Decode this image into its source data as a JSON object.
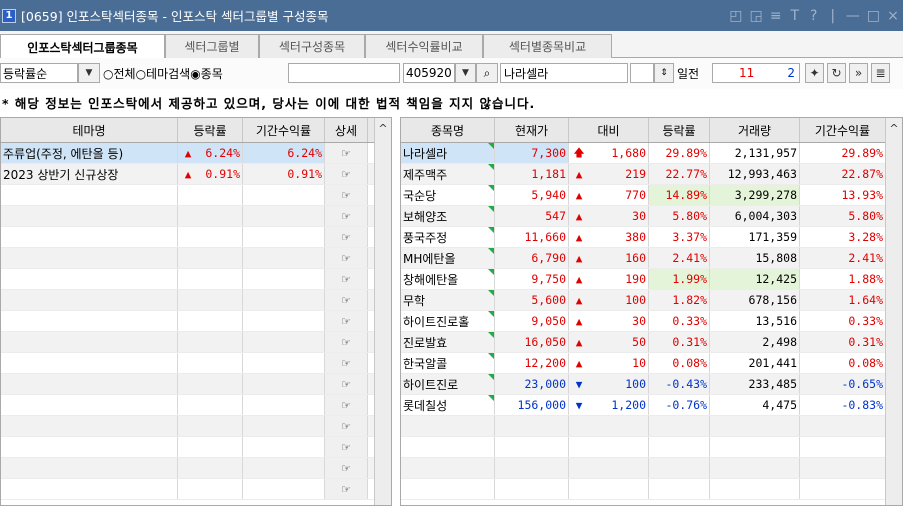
{
  "window": {
    "number": "1",
    "title": "[0659] 인포스탁섹터종목 - 인포스탁 섹터그룹별 구성종목",
    "controls": [
      "◰",
      "◲",
      "≡",
      "T",
      "?",
      "|",
      "—",
      "□",
      "×"
    ]
  },
  "tabs": [
    "인포스탁섹터그룹종목",
    "섹터그룹별",
    "섹터구성종목",
    "섹터수익률비교",
    "섹터별종목비교"
  ],
  "controls": {
    "sort_label": "등락률순",
    "radio_all": "○전체",
    "radio_theme": "○테마검색",
    "radio_stock": "◉종목",
    "code": "405920",
    "stock_name": "나라셀라",
    "days_label": "일전",
    "days_value": "11",
    "period_value": "2"
  },
  "notice": "* 해당 정보는 인포스탁에서 제공하고 있으며, 당사는 이에 대한 법적 책임을 지지 않습니다.",
  "theme_grid": {
    "headers": [
      "테마명",
      "등락률",
      "기간수익률",
      "상세"
    ],
    "rows": [
      {
        "name": "주류업(주정, 에탄올 등)",
        "arrow": "▲",
        "rate": "6.24%",
        "period": "6.24%",
        "selected": true
      },
      {
        "name": "2023 상반기 신규상장",
        "arrow": "▲",
        "rate": "0.91%",
        "period": "0.91%",
        "selected": false
      },
      {
        "name": "",
        "arrow": "",
        "rate": "",
        "period": ""
      },
      {
        "name": "",
        "arrow": "",
        "rate": "",
        "period": ""
      },
      {
        "name": "",
        "arrow": "",
        "rate": "",
        "period": ""
      },
      {
        "name": "",
        "arrow": "",
        "rate": "",
        "period": ""
      },
      {
        "name": "",
        "arrow": "",
        "rate": "",
        "period": ""
      },
      {
        "name": "",
        "arrow": "",
        "rate": "",
        "period": ""
      },
      {
        "name": "",
        "arrow": "",
        "rate": "",
        "period": ""
      },
      {
        "name": "",
        "arrow": "",
        "rate": "",
        "period": ""
      },
      {
        "name": "",
        "arrow": "",
        "rate": "",
        "period": ""
      },
      {
        "name": "",
        "arrow": "",
        "rate": "",
        "period": ""
      },
      {
        "name": "",
        "arrow": "",
        "rate": "",
        "period": ""
      },
      {
        "name": "",
        "arrow": "",
        "rate": "",
        "period": ""
      },
      {
        "name": "",
        "arrow": "",
        "rate": "",
        "period": ""
      },
      {
        "name": "",
        "arrow": "",
        "rate": "",
        "period": ""
      },
      {
        "name": "",
        "arrow": "",
        "rate": "",
        "period": ""
      }
    ],
    "detail_icon": "☞"
  },
  "stock_grid": {
    "headers": [
      "종목명",
      "현재가",
      "대비",
      "등락률",
      "거래량",
      "기간수익률"
    ],
    "rows": [
      {
        "name": "나라셀라",
        "price": "7,300",
        "arrow": "🡅",
        "change": "1,680",
        "rate": "29.89%",
        "volume": "2,131,957",
        "period": "29.89%",
        "dir": "up",
        "selected": true
      },
      {
        "name": "제주맥주",
        "price": "1,181",
        "arrow": "▲",
        "change": "219",
        "rate": "22.77%",
        "volume": "12,993,463",
        "period": "22.87%",
        "dir": "up"
      },
      {
        "name": "국순당",
        "price": "5,940",
        "arrow": "▲",
        "change": "770",
        "rate": "14.89%",
        "volume": "3,299,278",
        "period": "13.93%",
        "dir": "up",
        "hl": true
      },
      {
        "name": "보해양조",
        "price": "547",
        "arrow": "▲",
        "change": "30",
        "rate": "5.80%",
        "volume": "6,004,303",
        "period": "5.80%",
        "dir": "up"
      },
      {
        "name": "풍국주정",
        "price": "11,660",
        "arrow": "▲",
        "change": "380",
        "rate": "3.37%",
        "volume": "171,359",
        "period": "3.28%",
        "dir": "up"
      },
      {
        "name": "MH에탄올",
        "price": "6,790",
        "arrow": "▲",
        "change": "160",
        "rate": "2.41%",
        "volume": "15,808",
        "period": "2.41%",
        "dir": "up"
      },
      {
        "name": "창해에탄올",
        "price": "9,750",
        "arrow": "▲",
        "change": "190",
        "rate": "1.99%",
        "volume": "12,425",
        "period": "1.88%",
        "dir": "up",
        "hl": true
      },
      {
        "name": "무학",
        "price": "5,600",
        "arrow": "▲",
        "change": "100",
        "rate": "1.82%",
        "volume": "678,156",
        "period": "1.64%",
        "dir": "up"
      },
      {
        "name": "하이트진로홀",
        "price": "9,050",
        "arrow": "▲",
        "change": "30",
        "rate": "0.33%",
        "volume": "13,516",
        "period": "0.33%",
        "dir": "up"
      },
      {
        "name": "진로발효",
        "price": "16,050",
        "arrow": "▲",
        "change": "50",
        "rate": "0.31%",
        "volume": "2,498",
        "period": "0.31%",
        "dir": "up"
      },
      {
        "name": "한국알콜",
        "price": "12,200",
        "arrow": "▲",
        "change": "10",
        "rate": "0.08%",
        "volume": "201,441",
        "period": "0.08%",
        "dir": "up"
      },
      {
        "name": "하이트진로",
        "price": "23,000",
        "arrow": "▼",
        "change": "100",
        "rate": "-0.43%",
        "volume": "233,485",
        "period": "-0.65%",
        "dir": "down"
      },
      {
        "name": "롯데칠성",
        "price": "156,000",
        "arrow": "▼",
        "change": "1,200",
        "rate": "-0.76%",
        "volume": "4,475",
        "period": "-0.83%",
        "dir": "down"
      },
      {
        "name": "",
        "price": "",
        "arrow": "",
        "change": "",
        "rate": "",
        "volume": "",
        "period": "",
        "dir": ""
      },
      {
        "name": "",
        "price": "",
        "arrow": "",
        "change": "",
        "rate": "",
        "volume": "",
        "period": "",
        "dir": ""
      },
      {
        "name": "",
        "price": "",
        "arrow": "",
        "change": "",
        "rate": "",
        "volume": "",
        "period": "",
        "dir": ""
      },
      {
        "name": "",
        "price": "",
        "arrow": "",
        "change": "",
        "rate": "",
        "volume": "",
        "period": "",
        "dir": ""
      }
    ]
  },
  "colors": {
    "up": "#e00000",
    "down": "#0033cc",
    "title_bar": "#4a6d95",
    "selected_row": "#cfe4f6"
  }
}
